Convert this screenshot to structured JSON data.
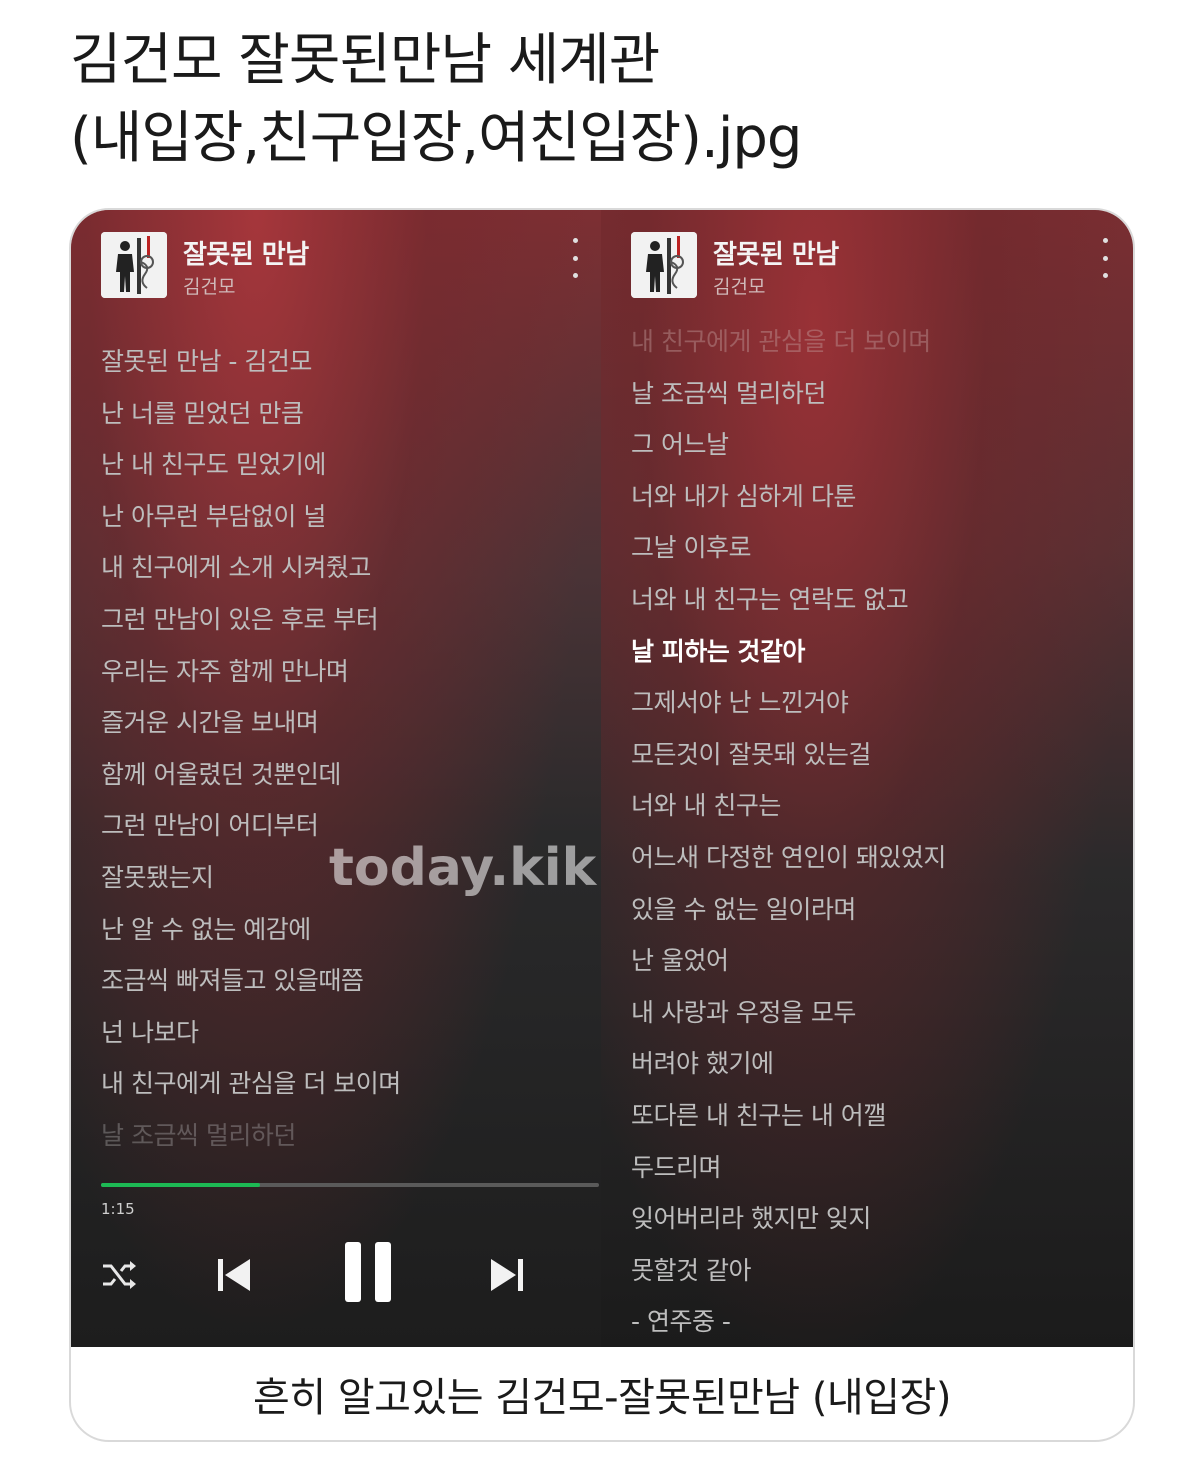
{
  "post": {
    "title_line1": "김건모 잘못된만남 세계관",
    "title_line2": "(내입장,친구입장,여친입장).jpg"
  },
  "left_panel": {
    "song_title": "잘못된 만남",
    "artist": "김건모",
    "lyrics": [
      "잘못된 만남 - 김건모",
      "난 너를 믿었던 만큼",
      "난 내 친구도 믿었기에",
      "난 아무런 부담없이 널",
      "내 친구에게 소개 시켜줬고",
      "그런 만남이 있은 후로 부터",
      "우리는 자주 함께 만나며",
      "즐거운 시간을 보내며",
      "함께 어울렸던 것뿐인데",
      "그런 만남이 어디부터",
      "잘못됐는지",
      "난 알 수 없는 예감에",
      "조금씩 빠져들고 있을때쯤",
      "넌 나보다",
      "내 친구에게 관심을 더 보이며",
      "날 조금씩 멀리하던"
    ],
    "progress_fraction": 0.32,
    "elapsed_time": "1:15",
    "watermark": "today.kik"
  },
  "right_panel": {
    "song_title": "잘못된 만남",
    "artist": "김건모",
    "lyrics": [
      "내 친구에게 관심을 더 보이며",
      "날 조금씩 멀리하던",
      "그 어느날",
      "너와 내가 심하게 다툰",
      "그날 이후로",
      "너와 내 친구는 연락도 없고",
      "날 피하는 것같아",
      "그제서야 난 느낀거야",
      "모든것이 잘못돼 있는걸",
      "너와 내 친구는",
      "어느새 다정한 연인이 돼있었지",
      "있을 수 없는 일이라며",
      "난 울었어",
      "내 사랑과 우정을 모두",
      "버려야 했기에",
      "또다른 내 친구는 내 어깰",
      "두드리며",
      "잊어버리라 했지만 잊지",
      "못할것 같아",
      "- 연주중 -"
    ],
    "active_line_index": 6
  },
  "caption": "흔히 알고있는 김건모-잘못된만남 (내입장)",
  "icons": {
    "more": "more-vertical-icon",
    "shuffle": "shuffle-icon",
    "previous": "skip-previous-icon",
    "pause": "pause-icon",
    "next": "skip-next-icon"
  },
  "colors": {
    "progress_accent": "#1db954",
    "lyrics_text": "#bdbdbd",
    "active_lyric": "#ffffff"
  }
}
